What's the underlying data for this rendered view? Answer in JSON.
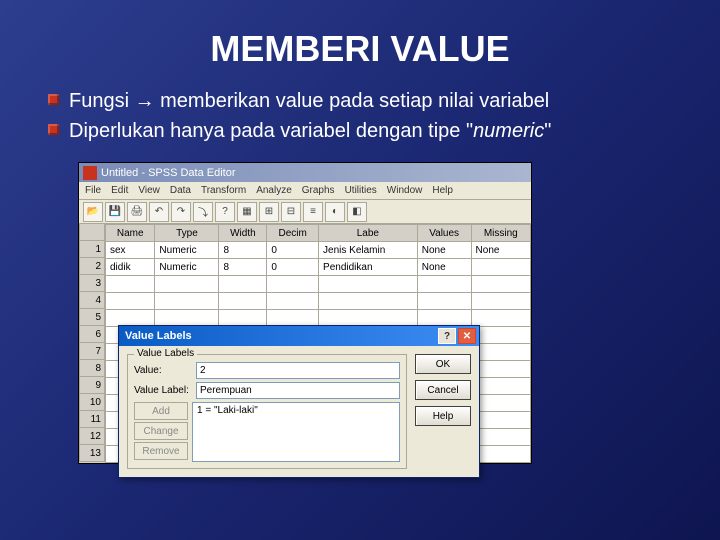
{
  "slide": {
    "title": "MEMBERI VALUE",
    "bullets": [
      "Fungsi → memberikan value pada setiap nilai variabel",
      "Diperlukan hanya pada variabel dengan tipe \"numeric\""
    ]
  },
  "spss": {
    "window_title": "Untitled - SPSS Data Editor",
    "menus": [
      "File",
      "Edit",
      "View",
      "Data",
      "Transform",
      "Analyze",
      "Graphs",
      "Utilities",
      "Window",
      "Help"
    ],
    "toolbar_icons": [
      "open",
      "save",
      "print",
      "",
      "undo",
      "redo",
      "",
      "goto",
      "find",
      "",
      "vars",
      "select",
      "weight",
      "labels",
      "",
      "chart",
      "pivot"
    ],
    "columns": [
      "Name",
      "Type",
      "Width",
      "Decim",
      "Labe",
      "Values",
      "Missing"
    ],
    "rows": [
      {
        "n": "1",
        "Name": "sex",
        "Type": "Numeric",
        "Width": "8",
        "Decim": "0",
        "Labe": "Jenis Kelamin",
        "Values": "None",
        "Missing": "None"
      },
      {
        "n": "2",
        "Name": "didik",
        "Type": "Numeric",
        "Width": "8",
        "Decim": "0",
        "Labe": "Pendidikan",
        "Values": "None",
        "Missing": ""
      }
    ],
    "empty_rows": [
      "3",
      "4",
      "5",
      "6",
      "7",
      "8",
      "9",
      "10",
      "11",
      "12",
      "13"
    ]
  },
  "dialog": {
    "title": "Value Labels",
    "groupbox": "Value Labels",
    "value_label": "Value:",
    "value_input": "2",
    "valname_label": "Value Label:",
    "valname_input": "Perempuan",
    "btn_add": "Add",
    "btn_change": "Change",
    "btn_remove": "Remove",
    "list_item": "1 = \"Laki-laki\"",
    "btn_ok": "OK",
    "btn_cancel": "Cancel",
    "btn_help": "Help"
  }
}
